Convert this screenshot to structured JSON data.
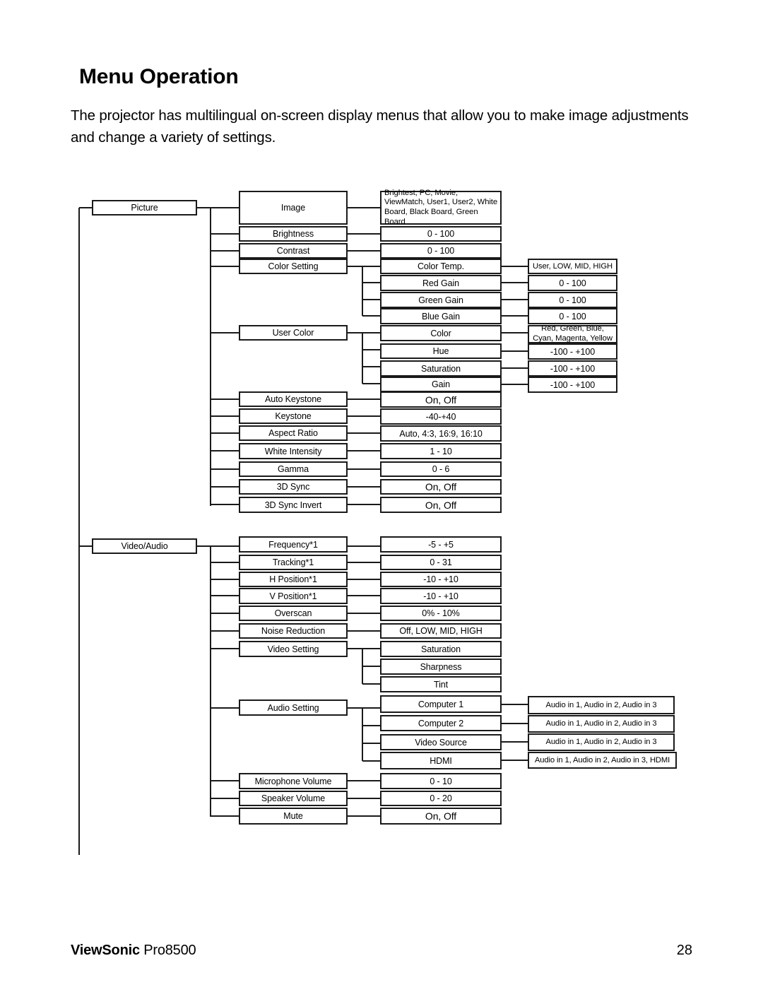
{
  "document": {
    "title": "Menu Operation",
    "intro": "The projector has multilingual on-screen display menus that allow you to make image adjustments and change a variety of settings.",
    "footer": {
      "brand": "ViewSonic",
      "model": "Pro8500",
      "page_number": "28"
    }
  },
  "diagram": {
    "type": "menu-tree",
    "root_branches": [
      "Picture",
      "Video/Audio"
    ],
    "level1": {
      "picture": "Picture",
      "video_audio": "Video/Audio"
    },
    "picture": {
      "items": [
        {
          "label": "Image",
          "value": "Brightest, PC, Movie, ViewMatch, User1, User2, White Board, Black Board, Green Board"
        },
        {
          "label": "Brightness",
          "value": "0 - 100"
        },
        {
          "label": "Contrast",
          "value": "0 - 100"
        },
        {
          "label": "Color Setting",
          "value": null
        },
        {
          "label": "User Color",
          "value": null
        },
        {
          "label": "Auto Keystone",
          "value": "On, Off"
        },
        {
          "label": "Keystone",
          "value": "-40-+40"
        },
        {
          "label": "Aspect Ratio",
          "value": "Auto, 4:3, 16:9, 16:10"
        },
        {
          "label": "White Intensity",
          "value": "1 - 10"
        },
        {
          "label": "Gamma",
          "value": "0 - 6"
        },
        {
          "label": "3D Sync",
          "value": "On, Off"
        },
        {
          "label": "3D Sync Invert",
          "value": "On, Off"
        }
      ],
      "color_setting": {
        "parent": "Color Setting",
        "items": [
          {
            "label": "Color Temp.",
            "value": "User, LOW, MID, HIGH"
          },
          {
            "label": "Red Gain",
            "value": "0 - 100"
          },
          {
            "label": "Green Gain",
            "value": "0 - 100"
          },
          {
            "label": "Blue Gain",
            "value": "0 - 100"
          }
        ]
      },
      "user_color": {
        "parent": "User Color",
        "items": [
          {
            "label": "Color",
            "value": "Red, Green, Blue, Cyan, Magenta, Yellow"
          },
          {
            "label": "Hue",
            "value": "-100 - +100"
          },
          {
            "label": "Saturation",
            "value": "-100 - +100"
          },
          {
            "label": "Gain",
            "value": "-100 - +100"
          }
        ]
      }
    },
    "video_audio": {
      "items": [
        {
          "label": "Frequency*1",
          "value": "-5 - +5"
        },
        {
          "label": "Tracking*1",
          "value": "0 - 31"
        },
        {
          "label": "H Position*1",
          "value": "-10 - +10"
        },
        {
          "label": "V Position*1",
          "value": "-10 - +10"
        },
        {
          "label": "Overscan",
          "value": "0% - 10%"
        },
        {
          "label": "Noise Reduction",
          "value": "Off, LOW, MID, HIGH"
        },
        {
          "label": "Video Setting",
          "value": null
        },
        {
          "label": "Audio Setting",
          "value": null
        },
        {
          "label": "Microphone Volume",
          "value": "0 - 10"
        },
        {
          "label": "Speaker Volume",
          "value": "0 - 20"
        },
        {
          "label": "Mute",
          "value": "On, Off"
        }
      ],
      "video_setting": {
        "parent": "Video Setting",
        "items": [
          {
            "label": "Saturation",
            "value": null
          },
          {
            "label": "Sharpness",
            "value": null
          },
          {
            "label": "Tint",
            "value": null
          }
        ]
      },
      "audio_setting": {
        "parent": "Audio Setting",
        "items": [
          {
            "label": "Computer 1",
            "value": "Audio in 1, Audio in 2, Audio in 3"
          },
          {
            "label": "Computer 2",
            "value": "Audio in 1, Audio in 2, Audio in 3"
          },
          {
            "label": "Video Source",
            "value": "Audio in 1, Audio in 2, Audio in 3"
          },
          {
            "label": "HDMI",
            "value": "Audio in 1, Audio in 2, Audio in 3, HDMI"
          }
        ]
      }
    }
  }
}
